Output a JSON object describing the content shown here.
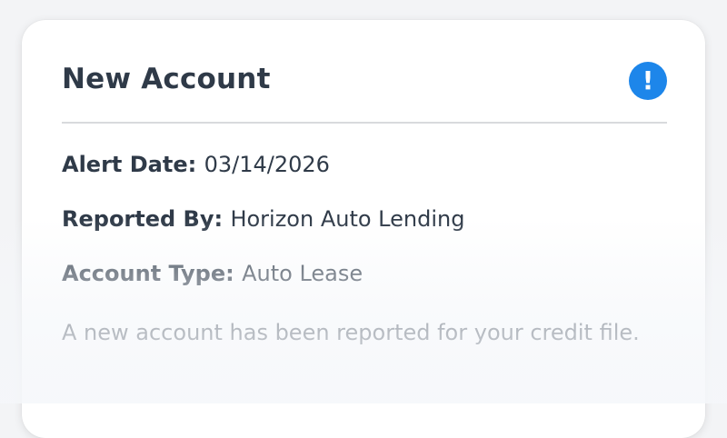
{
  "card": {
    "title": "New Account",
    "alert_icon": "!",
    "icon_color": "#1d86ea",
    "fields": [
      {
        "label": "Alert Date:",
        "value": "03/14/2026"
      },
      {
        "label": "Reported By:",
        "value": "Horizon Auto Lending"
      },
      {
        "label": "Account Type:",
        "value": "Auto Lease"
      }
    ],
    "description": "A new account has been reported for your credit file."
  }
}
